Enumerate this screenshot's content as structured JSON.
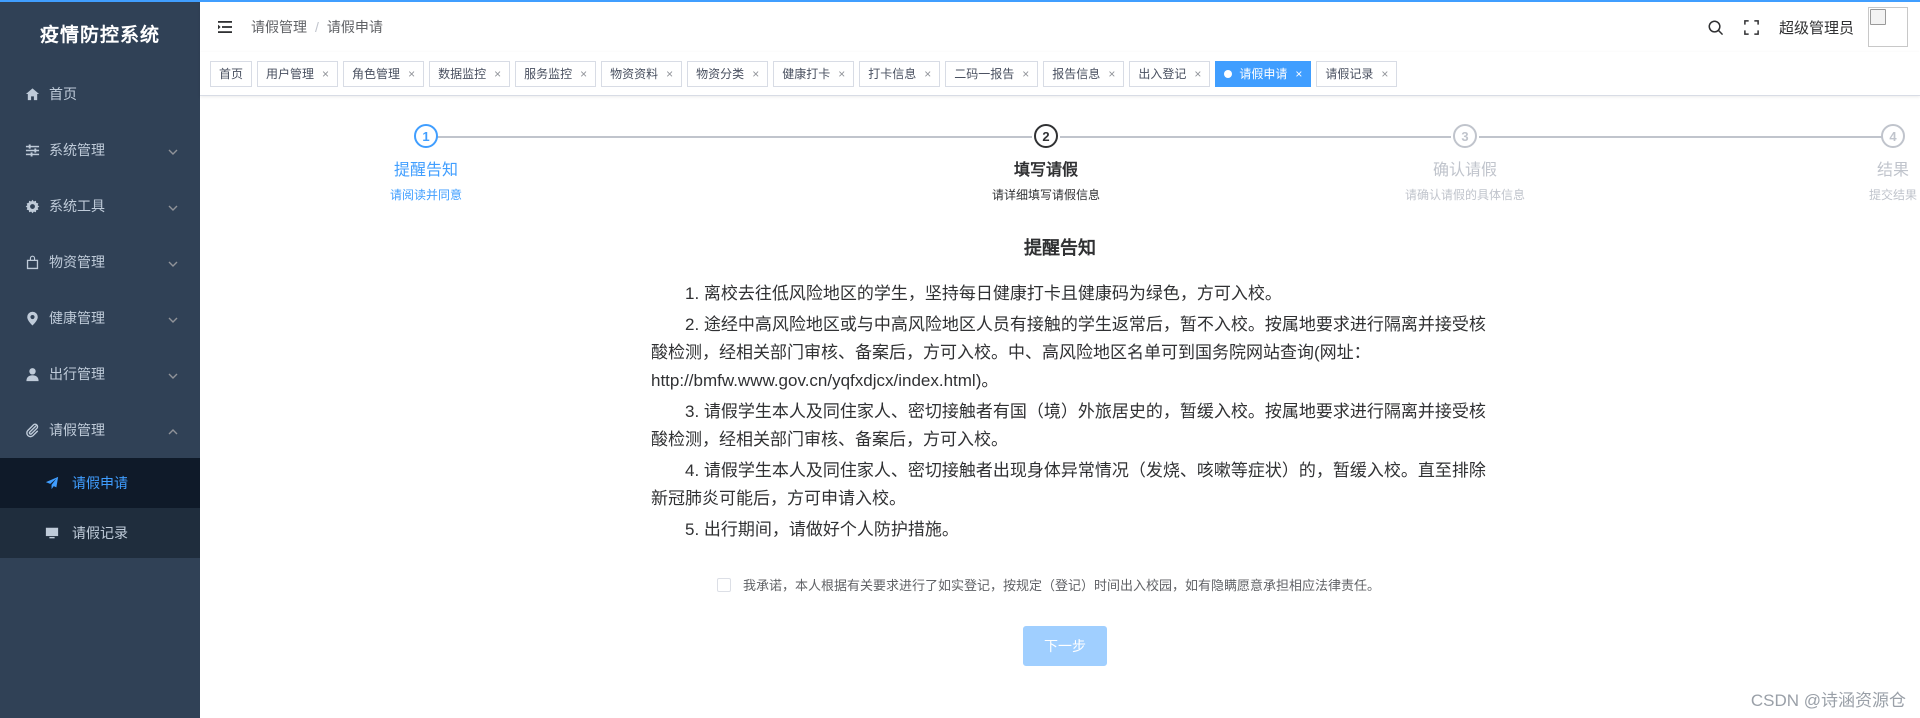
{
  "app": {
    "title": "疫情防控系统"
  },
  "sidebar": {
    "items": [
      {
        "label": "首页",
        "icon": "home-icon",
        "expandable": false
      },
      {
        "label": "系统管理",
        "icon": "sliders-icon",
        "expandable": true
      },
      {
        "label": "系统工具",
        "icon": "gear-icon",
        "expandable": true
      },
      {
        "label": "物资管理",
        "icon": "bag-icon",
        "expandable": true
      },
      {
        "label": "健康管理",
        "icon": "location-pin-icon",
        "expandable": true
      },
      {
        "label": "出行管理",
        "icon": "user-icon",
        "expandable": true
      },
      {
        "label": "请假管理",
        "icon": "paperclip-icon",
        "expandable": true,
        "expanded": true
      }
    ],
    "subitems": [
      {
        "label": "请假申请",
        "icon": "paper-plane-icon",
        "active": true
      },
      {
        "label": "请假记录",
        "icon": "monitor-icon",
        "active": false
      }
    ]
  },
  "navbar": {
    "breadcrumb": [
      "请假管理",
      "请假申请"
    ],
    "breadcrumb_sep": "/",
    "user_name": "超级管理员"
  },
  "tags": [
    {
      "label": "首页",
      "closable": false,
      "active": false
    },
    {
      "label": "用户管理",
      "closable": true,
      "active": false
    },
    {
      "label": "角色管理",
      "closable": true,
      "active": false
    },
    {
      "label": "数据监控",
      "closable": true,
      "active": false
    },
    {
      "label": "服务监控",
      "closable": true,
      "active": false
    },
    {
      "label": "物资资料",
      "closable": true,
      "active": false
    },
    {
      "label": "物资分类",
      "closable": true,
      "active": false
    },
    {
      "label": "健康打卡",
      "closable": true,
      "active": false
    },
    {
      "label": "打卡信息",
      "closable": true,
      "active": false
    },
    {
      "label": "二码一报告",
      "closable": true,
      "active": false
    },
    {
      "label": "报告信息",
      "closable": true,
      "active": false
    },
    {
      "label": "出入登记",
      "closable": true,
      "active": false
    },
    {
      "label": "请假申请",
      "closable": true,
      "active": true
    },
    {
      "label": "请假记录",
      "closable": true,
      "active": false
    }
  ],
  "tag_close": "×",
  "steps": [
    {
      "number": "1",
      "title": "提醒告知",
      "desc": "请阅读并同意",
      "state": "done"
    },
    {
      "number": "2",
      "title": "填写请假",
      "desc": "请详细填写请假信息",
      "state": "current"
    },
    {
      "number": "3",
      "title": "确认请假",
      "desc": "请确认请假的具体信息",
      "state": "wait"
    },
    {
      "number": "4",
      "title": "结果",
      "desc": "提交结果",
      "state": "wait"
    }
  ],
  "notice": {
    "title": "提醒告知",
    "paragraphs": [
      "1. 离校去往低风险地区的学生，坚持每日健康打卡且健康码为绿色，方可入校。",
      "2. 途经中高风险地区或与中高风险地区人员有接触的学生返常后，暂不入校。按属地要求进行隔离并接受核酸检测，经相关部门审核、备案后，方可入校。中、高风险地区名单可到国务院网站查询(网址：http://bmfw.www.gov.cn/yqfxdjcx/index.html)。",
      "3. 请假学生本人及同住家人、密切接触者有国（境）外旅居史的，暂缓入校。按属地要求进行隔离并接受核酸检测，经相关部门审核、备案后，方可入校。",
      "4. 请假学生本人及同住家人、密切接触者出现身体异常情况（发烧、咳嗽等症状）的，暂缓入校。直至排除新冠肺炎可能后，方可申请入校。",
      "5. 出行期间，请做好个人防护措施。"
    ]
  },
  "agreement": {
    "label": "我承诺，本人根据有关要求进行了如实登记，按规定（登记）时间出入校园，如有隐瞒愿意承担相应法律责任。",
    "checked": false
  },
  "next_button": {
    "label": "下一步",
    "disabled": true
  },
  "watermark": "CSDN @诗涵资源仓",
  "colors": {
    "accent": "#409eff",
    "sidebar_bg": "#304156",
    "sidebar_text": "#bfcbd9",
    "disabled_button": "#a0cfff"
  }
}
